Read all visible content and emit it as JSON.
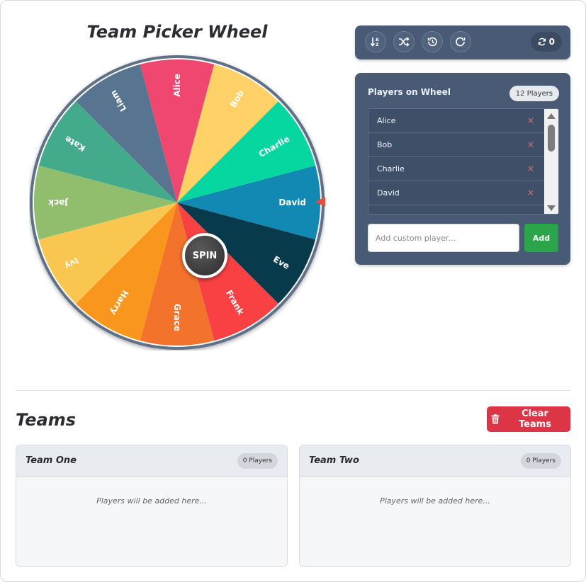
{
  "wheel": {
    "title": "Team Picker Wheel",
    "spin_label": "SPIN",
    "segments": [
      {
        "label": "David",
        "color": "#1289b3"
      },
      {
        "label": "Eve",
        "color": "#073b4c"
      },
      {
        "label": "Frank",
        "color": "#f94144"
      },
      {
        "label": "Grace",
        "color": "#f3722c"
      },
      {
        "label": "Harry",
        "color": "#f8961e"
      },
      {
        "label": "Ivy",
        "color": "#f9c74f"
      },
      {
        "label": "Jack",
        "color": "#90be6d"
      },
      {
        "label": "Kate",
        "color": "#43aa8b"
      },
      {
        "label": "Liam",
        "color": "#577590"
      },
      {
        "label": "Alice",
        "color": "#ef476f"
      },
      {
        "label": "Bob",
        "color": "#ffd166"
      },
      {
        "label": "Charlie",
        "color": "#06d6a0"
      }
    ],
    "pointer_color": "#e74c3c"
  },
  "toolbar": {
    "sort_icon": "sort-alpha-icon",
    "shuffle_icon": "shuffle-icon",
    "history_icon": "history-icon",
    "reset_icon": "redo-icon",
    "spin_count": "0"
  },
  "players": {
    "title": "Players on Wheel",
    "count_badge": "12 Players",
    "items": [
      "Alice",
      "Bob",
      "Charlie",
      "David"
    ],
    "remove_glyph": "×",
    "input_placeholder": "Add custom player...",
    "add_label": "Add"
  },
  "teams": {
    "title": "Teams",
    "clear_label": "Clear Teams",
    "list": [
      {
        "name": "Team One",
        "count": "0 Players",
        "empty": "Players will be added here..."
      },
      {
        "name": "Team Two",
        "count": "0 Players",
        "empty": "Players will be added here..."
      }
    ]
  },
  "colors": {
    "panel": "#485a74",
    "add_button": "#2aa54a",
    "clear_button": "#dc3545"
  }
}
